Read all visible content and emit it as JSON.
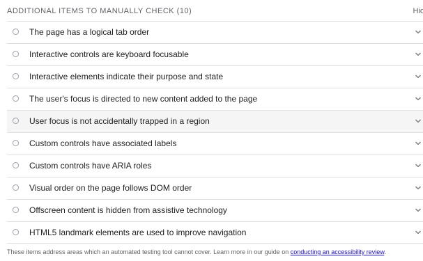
{
  "section": {
    "title": "ADDITIONAL ITEMS TO MANUALLY CHECK (10)",
    "hide_label": "Hid"
  },
  "items": [
    {
      "label": "The page has a logical tab order"
    },
    {
      "label": "Interactive controls are keyboard focusable"
    },
    {
      "label": "Interactive elements indicate their purpose and state"
    },
    {
      "label": "The user's focus is directed to new content added to the page"
    },
    {
      "label": "User focus is not accidentally trapped in a region"
    },
    {
      "label": "Custom controls have associated labels"
    },
    {
      "label": "Custom controls have ARIA roles"
    },
    {
      "label": "Visual order on the page follows DOM order"
    },
    {
      "label": "Offscreen content is hidden from assistive technology"
    },
    {
      "label": "HTML5 landmark elements are used to improve navigation"
    }
  ],
  "footer": {
    "text": "These items address areas which an automated testing tool cannot cover. Learn more in our guide on ",
    "link_text": "conducting an accessibility review",
    "end": "."
  },
  "colors": {
    "text": "#212121",
    "muted": "#5f6368",
    "divider": "#e0e0e0",
    "link": "#1a0dab",
    "row_highlight": "#f5f5f5"
  },
  "icons": {
    "status": "circle-outline-icon",
    "expand": "chevron-down-icon"
  }
}
